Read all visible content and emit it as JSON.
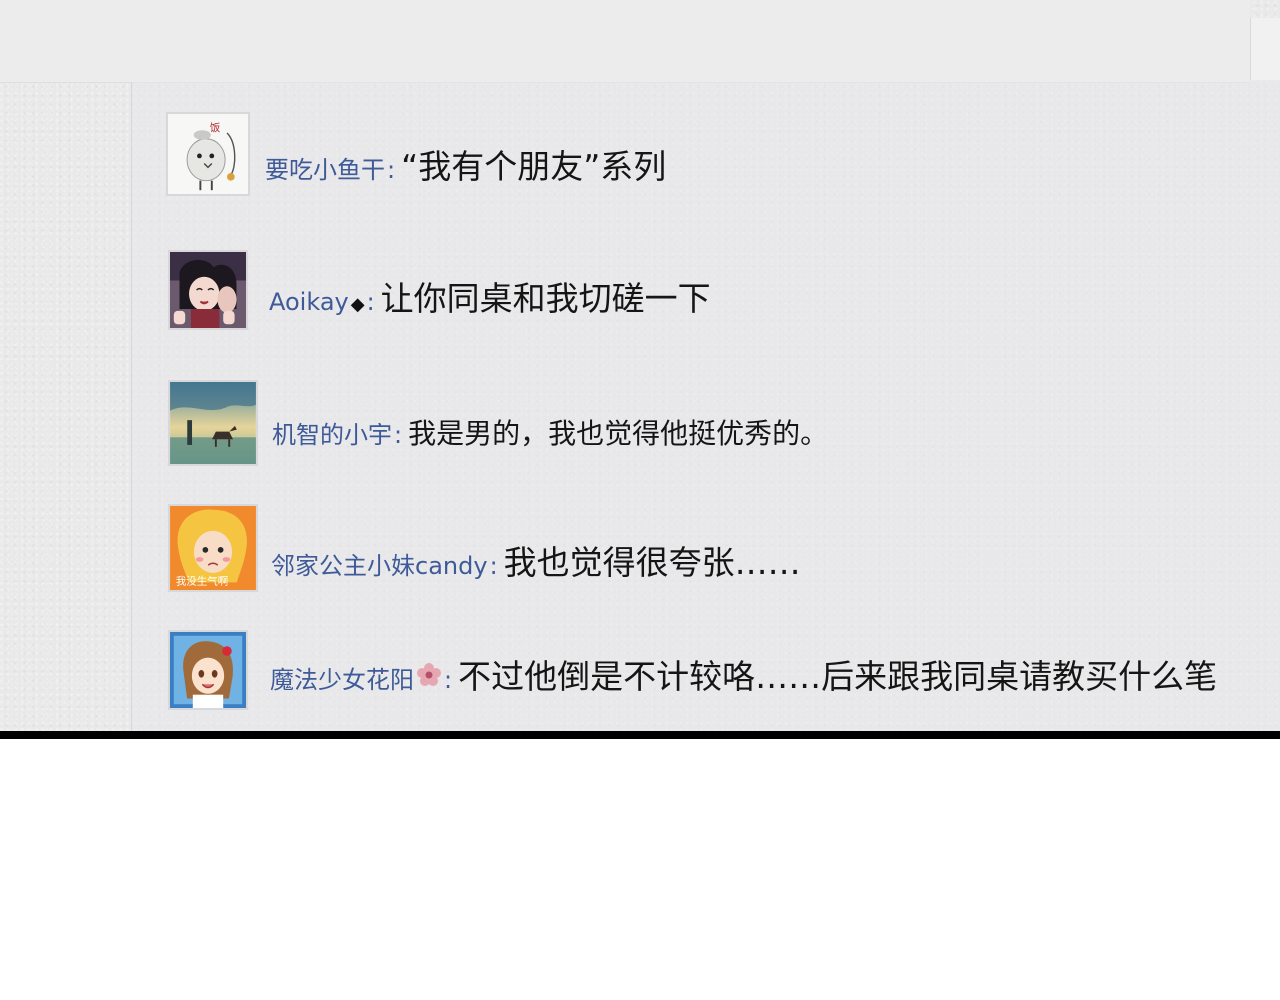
{
  "comments": [
    {
      "username": "要吃小鱼干",
      "colon": ":",
      "text": "“我有个朋友”系列",
      "avatar_desc": "bird-sticker",
      "avatar_glyph": "饭"
    },
    {
      "username": "Aoikay",
      "badge": "◆",
      "colon": ":",
      "text": "让你同桌和我切磋一下",
      "avatar_desc": "anime-girl"
    },
    {
      "username": "机智的小宇",
      "colon": ":",
      "text": "我是男的，我也觉得他挺优秀的。",
      "avatar_desc": "landscape-horse"
    },
    {
      "username": "邻家公主小妹candy",
      "colon": ":",
      "text": "我也觉得很夸张……",
      "avatar_desc": "cartoon-princess",
      "avatar_caption": "我没生气啊"
    },
    {
      "username": "魔法少女花阳",
      "badge": "flower",
      "colon": ":",
      "text": "不过他倒是不计较咯……后来跟我同桌请教买什么笔",
      "avatar_desc": "anime-hanayo"
    }
  ],
  "colors": {
    "username": "#3e5a98",
    "text": "#151515",
    "paper": "#e9e9ea"
  }
}
